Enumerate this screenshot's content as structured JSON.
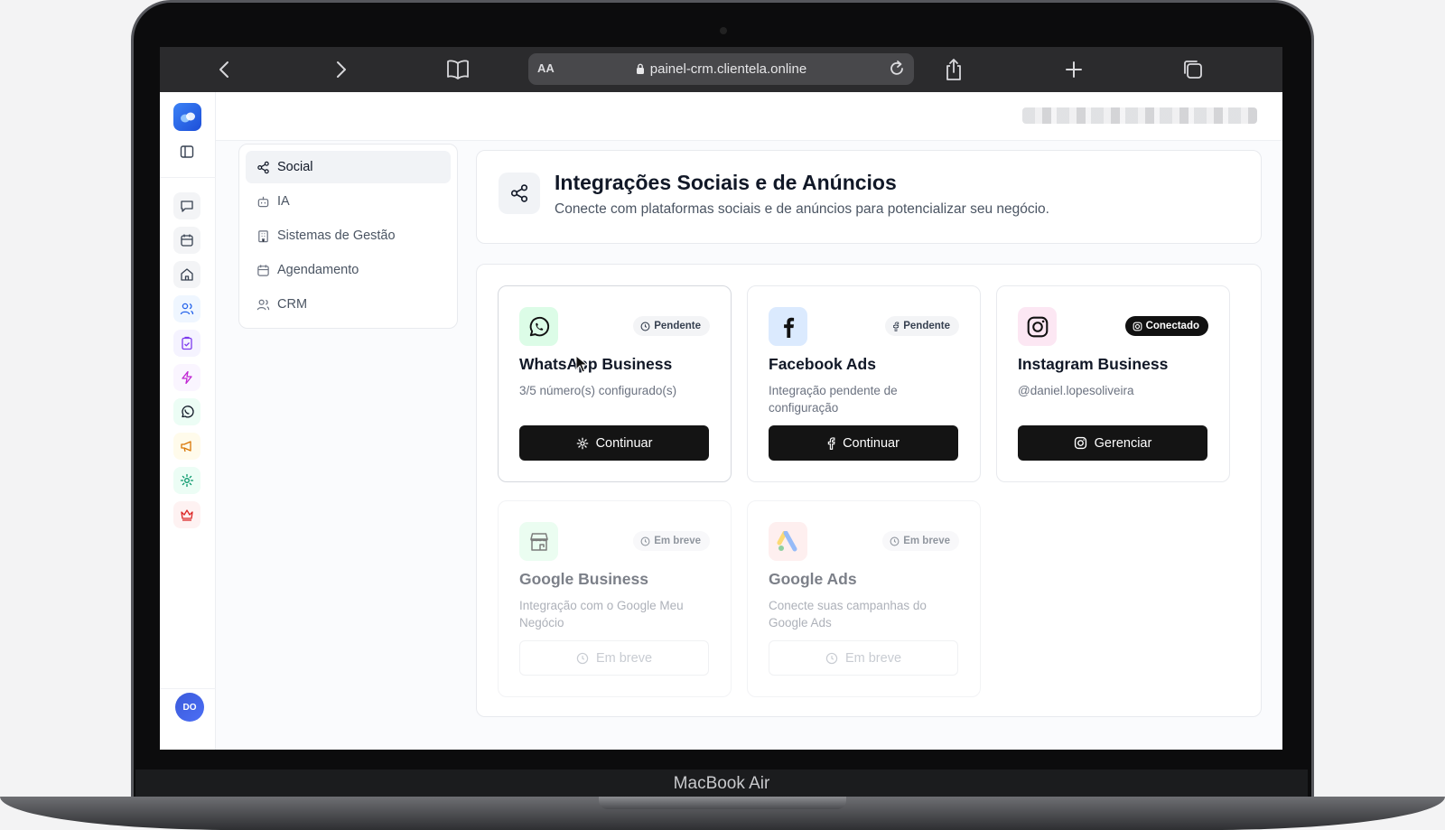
{
  "device": {
    "brand_label": "MacBook Air"
  },
  "browser": {
    "reader_label": "AA",
    "url": "painel-crm.clientela.online"
  },
  "rail": {
    "avatar_initials": "DO",
    "icons": [
      "chat-icon",
      "calendar-icon",
      "home-icon",
      "users-icon",
      "clipboard-check-icon",
      "zap-icon",
      "whatsapp-icon",
      "megaphone-icon",
      "settings-gear-icon",
      "crown-icon"
    ]
  },
  "settings_nav": {
    "items": [
      {
        "label": "Social",
        "icon": "share-icon",
        "active": true
      },
      {
        "label": "IA",
        "icon": "bot-icon",
        "active": false
      },
      {
        "label": "Sistemas de Gestão",
        "icon": "building-icon",
        "active": false
      },
      {
        "label": "Agendamento",
        "icon": "calendar-icon",
        "active": false
      },
      {
        "label": "CRM",
        "icon": "users-icon",
        "active": false
      }
    ]
  },
  "header": {
    "title": "Integrações Sociais e de Anúncios",
    "subtitle": "Conecte com plataformas sociais e de anúncios para potencializar seu negócio."
  },
  "integrations": [
    {
      "name": "WhatsApp Business",
      "status": "Pendente",
      "description": "3/5 número(s) configurado(s)",
      "button": "Continuar",
      "color": "#16a34a"
    },
    {
      "name": "Facebook Ads",
      "status": "Pendente",
      "description": "Integração pendente de configuração",
      "button": "Continuar",
      "color": "#1877f2"
    },
    {
      "name": "Instagram Business",
      "status": "Conectado",
      "description": "@daniel.lopesoliveira",
      "button": "Gerenciar",
      "color": "#e1306c"
    },
    {
      "name": "Google Business",
      "status": "Em breve",
      "description": "Integração com o Google Meu Negócio",
      "button": "Em breve",
      "color": "#16a34a"
    },
    {
      "name": "Google Ads",
      "status": "Em breve",
      "description": "Conecte suas campanhas do Google Ads",
      "button": "Em breve",
      "color": "#ea4335"
    }
  ]
}
